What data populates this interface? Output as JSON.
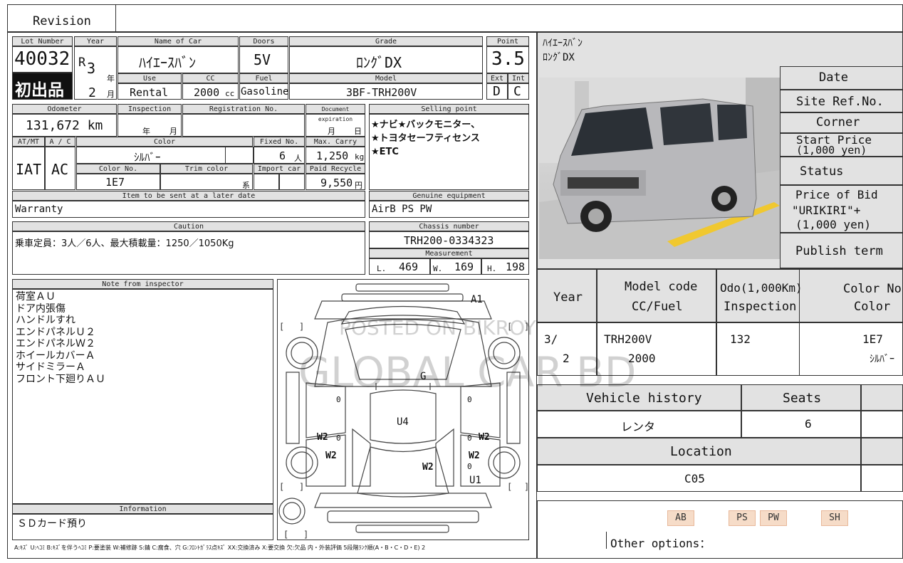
{
  "revision_label": "Revision",
  "sheet": {
    "lot_number_label": "Lot Number",
    "lot_number": "40032",
    "year_label": "Year",
    "era": "R",
    "year": "3",
    "nen": "年",
    "month": "2",
    "tsuki": "月",
    "first_reg": "初出品",
    "name_label": "Name of Car",
    "name": "ﾊｲｴｰｽﾊﾞﾝ",
    "doors_label": "Doors",
    "doors": "5V",
    "grade_label": "Grade",
    "grade": "ﾛﾝｸﾞDX",
    "point_label": "Point",
    "point": "3.5",
    "use_label": "Use",
    "use": "Rental",
    "cc_label": "CC",
    "cc": "2000",
    "cc_unit": "cc",
    "fuel_label": "Fuel",
    "fuel": "Gasoline",
    "model_label": "Model",
    "model": "3BF-TRH200V",
    "ext_label": "Ext",
    "ext": "D",
    "int_label": "Int",
    "int": "C",
    "odometer_label": "Odometer",
    "odometer": "131,672 km",
    "inspection_label": "Inspection",
    "insp_nen": "年",
    "insp_tsuki": "月",
    "registration_label": "Registration No.",
    "doc_exp_label": "Document expiration",
    "doc_tsuki": "月",
    "doc_hi": "日",
    "selling_label": "Selling point",
    "selling_text": "★ナビ★バックモニター、\n★トヨタセーフティセンス\n★ETC",
    "atmt_label": "AT/MT",
    "atmt": "IAT",
    "ac_label": "A / C",
    "ac": "AC",
    "color_label": "Color",
    "color": "ｼﾙﾊﾞｰ",
    "fixed_label": "Fixed No.",
    "fixed": "6",
    "fixed_unit": "人",
    "maxcarry_label": "Max. Carry",
    "maxcarry": "1,250",
    "maxcarry_unit": "kg",
    "colorno_label": "Color No.",
    "colorno": "1E7",
    "trim_label": "Trim color",
    "trim_unit": "系",
    "import_label": "Import car",
    "recycle_label": "Paid Recycle",
    "recycle": "9,550",
    "recycle_unit": "円",
    "later_label": "Item to be sent at a later date",
    "later": "Warranty",
    "genuine_label": "Genuine equipment",
    "genuine": "AirB PS PW",
    "caution_label": "Caution",
    "caution": "乗車定員：3人／6人、最大積載量：1250／1050Kg",
    "chassis_label": "Chassis number",
    "chassis": "TRH200-0334323",
    "measure_label": "Measurement",
    "meas_l_label": "L.",
    "meas_l": "469",
    "meas_w_label": "W.",
    "meas_w": "169",
    "meas_h_label": "H.",
    "meas_h": "198",
    "note_label": "Note from inspector",
    "note_text": "荷室ＡＵ\nドア内張傷\nハンドルすれ\nエンドパネルＵ２\nエンドパネルＷ２\nホイールカバーＡ\nサイドミラーＡ\nフロント下廻りＡＵ",
    "info_label": "Information",
    "info": "ＳＤカード預り",
    "legend": "A:ｷｽﾞ U:ﾍｺﾐ B:ｷｽﾞを伴うﾍｺﾐ P:要塗装 W:補修跡 S:錆 C:腐食、穴 G:ﾌﾛﾝﾄｶﾞﾗｽ点ｷｽﾞ XX:交換済み X:要交換 欠:欠品 内・外装評価 5段階ﾗﾝｸ順(A・B・C・D・E) 2",
    "diagram_marks": {
      "a1": "A1",
      "g": "G",
      "u4": "U4",
      "w2a": "W2",
      "w2b": "W2",
      "w2c": "W2",
      "w2d": "W2",
      "w2e": "W2",
      "u1": "U1",
      "zero1": "0",
      "zero2": "0",
      "zero3": "0",
      "zero4": "0",
      "zero5": "0"
    }
  },
  "right": {
    "title_line1": "ﾊｲｴｰｽﾊﾞﾝ",
    "title_line2": "ﾛﾝｸﾞDX",
    "date_label": "Date",
    "site_ref_label": "Site Ref.No.",
    "corner_label": "Corner",
    "start_price_label": "Start Price",
    "start_price_unit": "(1,000 yen)",
    "status_label": "Status",
    "price_bid_label1": "Price of Bid",
    "price_bid_label2": "\"URIKIRI\"+",
    "price_bid_label3": "(1,000 yen)",
    "publish_label": "Publish term",
    "year_col": "Year",
    "model_code_col1": "Model code",
    "model_code_col2": "CC/Fuel",
    "odo_col1": "Odo(1,000Km)",
    "odo_col2": "Inspection",
    "color_col1": "Color No.",
    "color_col2": "Color",
    "year_val1": "3/",
    "year_val2": "2",
    "model_code_val": "TRH200V",
    "cc_val": "2000",
    "odo_val": "132",
    "color_no_val": "1E7",
    "color_val": "ｼﾙﾊﾞｰ",
    "history_label": "Vehicle history",
    "seats_label": "Seats",
    "history_val": "レンタ",
    "seats_val": "6",
    "location_label": "Location",
    "location_val": "C05",
    "badges": [
      "AB",
      "PS",
      "PW",
      "SH"
    ],
    "other_options_label": "Other options："
  },
  "watermark1": "POSTED ON BIKROY",
  "watermark2": "GLOBAL CAR BD"
}
